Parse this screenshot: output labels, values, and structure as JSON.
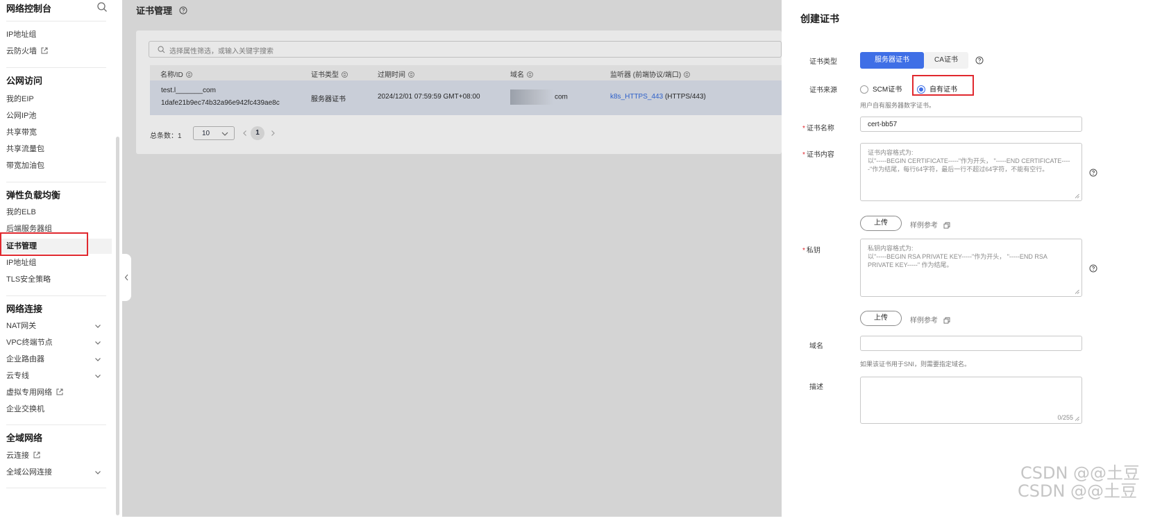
{
  "sidebar": {
    "title": "网络控制台",
    "items_top": [
      "IP地址组",
      "云防火墙"
    ],
    "group_public": "公网访问",
    "public_items": [
      "我的EIP",
      "公网IP池",
      "共享带宽",
      "共享流量包",
      "带宽加油包"
    ],
    "group_elb": "弹性负载均衡",
    "elb_items": [
      "我的ELB",
      "后端服务器组",
      "证书管理",
      "IP地址组",
      "TLS安全策略"
    ],
    "group_conn": "网络连接",
    "conn_items": [
      "NAT网关",
      "VPC终端节点",
      "企业路由器",
      "云专线",
      "虚拟专用网络",
      "企业交换机"
    ],
    "group_global": "全域网络",
    "global_items": [
      "云连接",
      "全域公网连接"
    ]
  },
  "main": {
    "title": "证书管理",
    "filter_placeholder": "选择属性筛选，或输入关键字搜索",
    "columns": [
      "名称/ID",
      "证书类型",
      "过期时间",
      "域名",
      "监听器 (前端协议/端口)"
    ],
    "row": {
      "name": "test.l_______com",
      "id": "1dafe21b9ec74b32a96e942fc439ae8c",
      "type": "服务器证书",
      "expire": "2024/12/01 07:59:59 GMT+08:00",
      "domain_suffix": "com",
      "listener_link": "k8s_HTTPS_443",
      "listener_proto": "(HTTPS/443)"
    },
    "pagination": {
      "total": "总条数：1",
      "page_size": "10",
      "current_page": "1"
    }
  },
  "drawer": {
    "title": "创建证书",
    "cert_type_label": "证书类型",
    "cert_type_options": [
      "服务器证书",
      "CA证书"
    ],
    "cert_source_label": "证书来源",
    "cert_source_options": [
      "SCM证书",
      "自有证书"
    ],
    "cert_source_hint": "用户自有服务器数字证书。",
    "cert_name_label": "证书名称",
    "cert_name_value": "cert-bb57",
    "cert_content_label": "证书内容",
    "cert_content_placeholder": "证书内容格式为:\n以\"-----BEGIN CERTIFICATE-----\"作为开头， \"-----END CERTIFICATE-----\"作为结尾，每行64字符，最后一行不超过64字符，不能有空行。",
    "upload_label": "上传",
    "example_label": "样例参考",
    "private_key_label": "私钥",
    "private_key_placeholder": "私钥内容格式为:\n以\"-----BEGIN RSA PRIVATE KEY-----\"作为开头， \"-----END RSA PRIVATE KEY-----\" 作为结尾。",
    "domain_label": "域名",
    "domain_value": "",
    "domain_hint": "如果该证书用于SNI，则需要指定域名。",
    "desc_label": "描述",
    "desc_value": "",
    "desc_count": "0/255"
  },
  "watermark": "CSDN @@土豆",
  "colors": {
    "primary": "#3f6fe6",
    "highlight_box": "#e0282e",
    "required": "#e0282e",
    "link": "#2c5fc9"
  }
}
